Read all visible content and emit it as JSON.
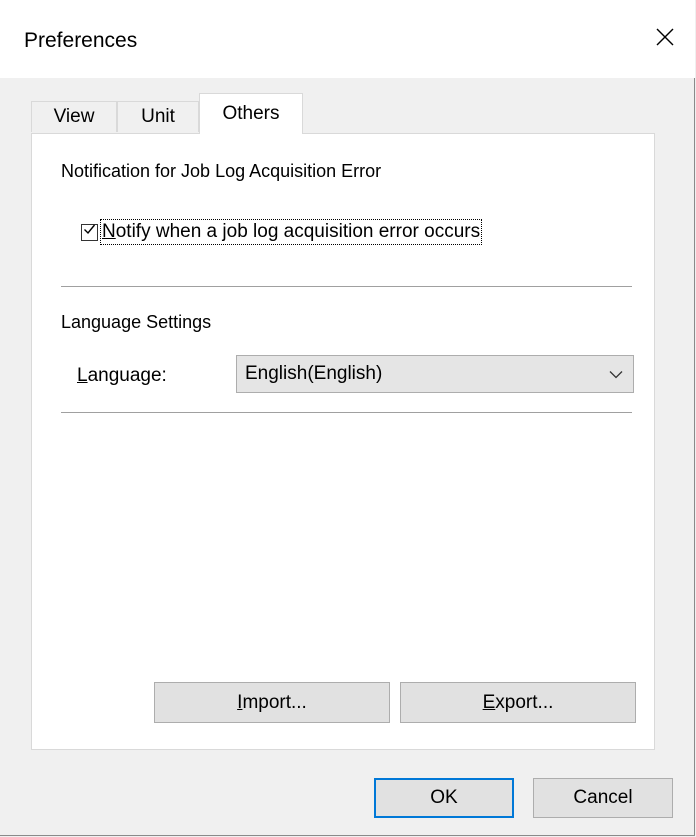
{
  "window": {
    "title": "Preferences"
  },
  "tabs": [
    {
      "label": "View",
      "active": false
    },
    {
      "label": "Unit",
      "active": false
    },
    {
      "label": "Others",
      "active": true
    }
  ],
  "notification": {
    "heading": "Notification for Job Log Acquisition Error",
    "checkbox": {
      "label_mnemonic": "N",
      "label_rest": "otify when a job log acquisition error occurs",
      "checked": true
    }
  },
  "language_settings": {
    "heading": "Language Settings",
    "label_mnemonic": "L",
    "label_rest": "anguage:",
    "selected": "English(English)"
  },
  "panel_buttons": {
    "import_mnemonic": "I",
    "import_rest": "mport...",
    "export_mnemonic": "E",
    "export_rest": "xport..."
  },
  "dialog_buttons": {
    "ok": "OK",
    "cancel": "Cancel"
  },
  "colors": {
    "accent": "#0078d7",
    "titlebar": "#ffffff",
    "dialog_bg": "#f0f0f0"
  }
}
